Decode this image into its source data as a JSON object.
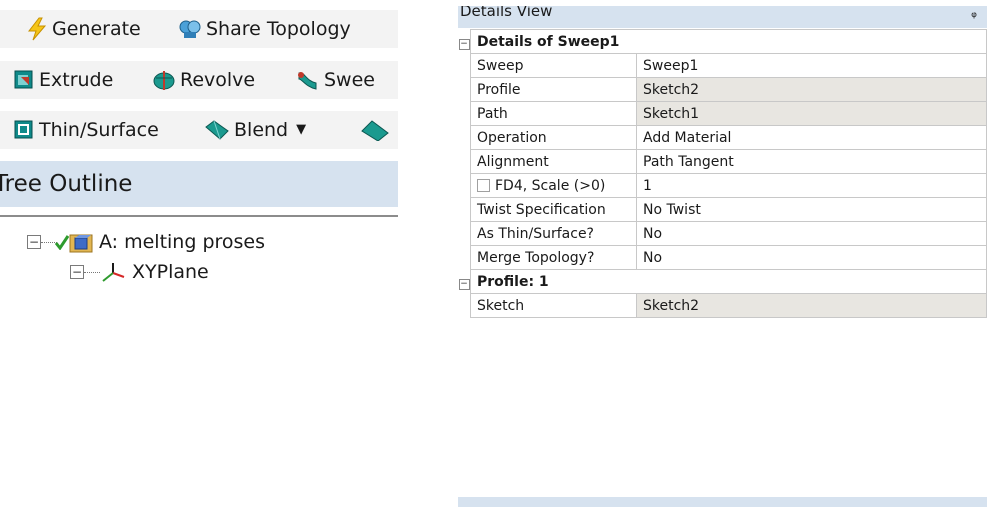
{
  "toolbar": {
    "row1": [
      {
        "label": "Generate",
        "icon": "lightning-icon"
      },
      {
        "label": "Share Topology",
        "icon": "share-topology-icon"
      }
    ],
    "row2": [
      {
        "label": "Extrude",
        "icon": "extrude-icon"
      },
      {
        "label": "Revolve",
        "icon": "revolve-icon"
      },
      {
        "label": "Swee",
        "icon": "sweep-icon"
      }
    ],
    "row3": [
      {
        "label": "Thin/Surface",
        "icon": "thin-surface-icon"
      },
      {
        "label": "Blend",
        "icon": "blend-icon"
      }
    ]
  },
  "tree": {
    "header": "Tree Outline",
    "root": {
      "label": "A: melting proses",
      "expander": "−"
    },
    "child": {
      "label": "XYPlane",
      "expander": "−"
    }
  },
  "details": {
    "title": "Details View",
    "pin": "ᵩ",
    "group1": {
      "label": "Details of Sweep1",
      "expander": "−",
      "rows": [
        {
          "key": "Sweep",
          "value": "Sweep1",
          "shaded": false
        },
        {
          "key": "Profile",
          "value": "Sketch2",
          "shaded": true
        },
        {
          "key": "Path",
          "value": "Sketch1",
          "shaded": true
        },
        {
          "key": "Operation",
          "value": "Add Material",
          "shaded": false
        },
        {
          "key": "Alignment",
          "value": "Path Tangent",
          "shaded": false
        },
        {
          "key": "FD4,  Scale (>0)",
          "value": "1",
          "shaded": false,
          "checkbox": true
        },
        {
          "key": "Twist Specification",
          "value": "No Twist",
          "shaded": false
        },
        {
          "key": "As Thin/Surface?",
          "value": "No",
          "shaded": false
        },
        {
          "key": "Merge Topology?",
          "value": "No",
          "shaded": false
        }
      ]
    },
    "group2": {
      "label": "Profile: 1",
      "expander": "−",
      "rows": [
        {
          "key": "Sketch",
          "value": "Sketch2",
          "shaded": true
        }
      ]
    }
  },
  "colors": {
    "header_bg": "#d6e2ef",
    "shaded_cell": "#e8e6e1",
    "grid_line": "#c8c8c8"
  }
}
